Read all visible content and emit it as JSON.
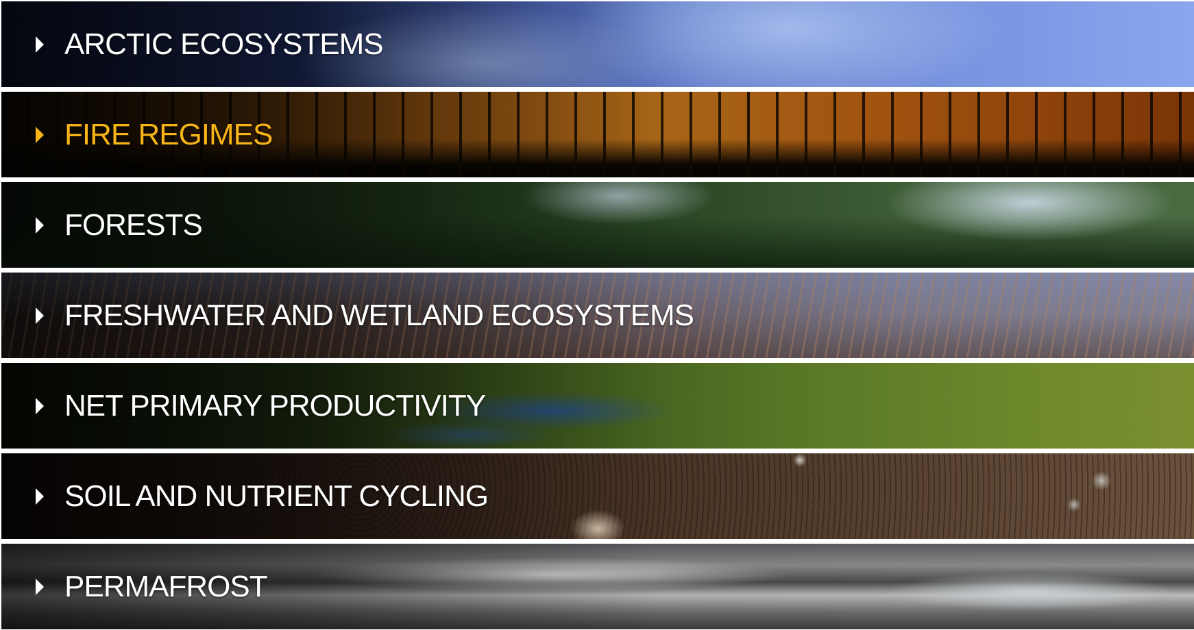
{
  "accordion": {
    "items": [
      {
        "label": "ARCTIC ECOSYSTEMS",
        "active": false
      },
      {
        "label": "FIRE REGIMES",
        "active": true
      },
      {
        "label": "FORESTS",
        "active": false
      },
      {
        "label": "FRESHWATER AND WETLAND ECOSYSTEMS",
        "active": false
      },
      {
        "label": "NET PRIMARY PRODUCTIVITY",
        "active": false
      },
      {
        "label": "SOIL AND NUTRIENT CYCLING",
        "active": false
      },
      {
        "label": "PERMAFROST",
        "active": false
      }
    ]
  },
  "colors": {
    "label_default": "#ffffff",
    "label_active": "#f7b418",
    "separator": "#ffffff"
  },
  "icons": {
    "expand": "caret-right-icon"
  }
}
